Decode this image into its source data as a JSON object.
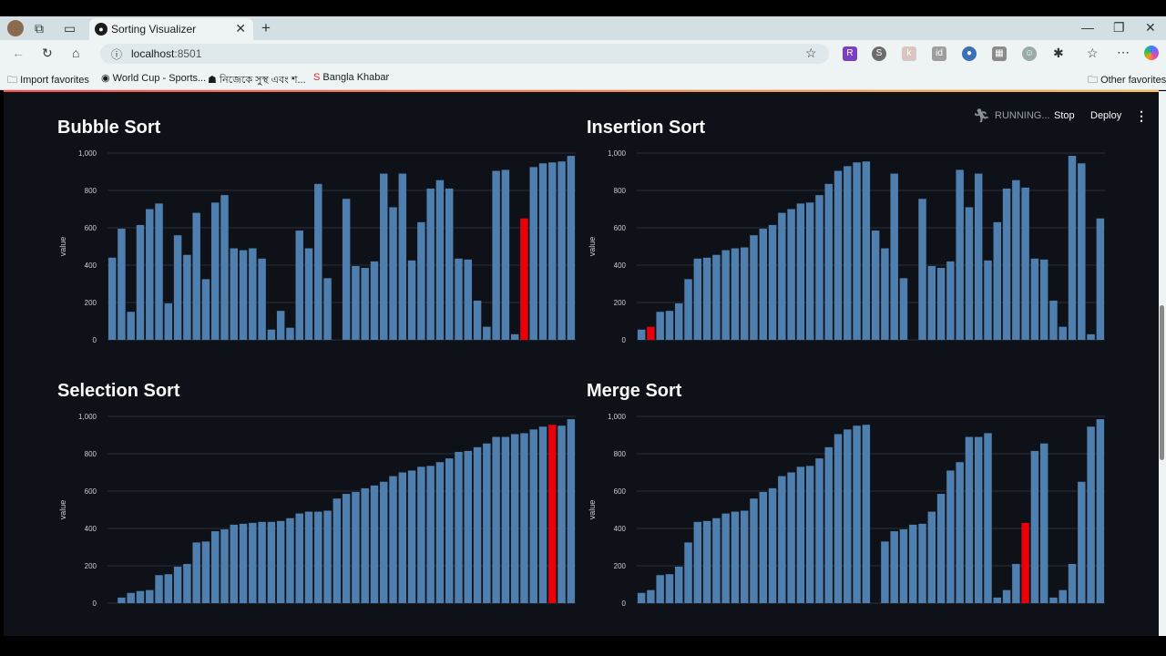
{
  "browser": {
    "tab_title": "Sorting Visualizer",
    "tab_favicon": "streamlit-icon",
    "url_host": "localhost",
    "url_port": ":8501",
    "favorites": [
      {
        "label": "Import favorites"
      },
      {
        "label": "World Cup - Sports..."
      },
      {
        "label": "নিজেকে সুস্থ এবং শ..."
      },
      {
        "label": "Bangla Khabar"
      }
    ],
    "other_favorites": "Other favorites"
  },
  "app_header": {
    "status": "RUNNING...",
    "stop": "Stop",
    "deploy": "Deploy"
  },
  "colors": {
    "bar": "#4e7fae",
    "highlight": "#e8000b",
    "background": "#0e1117",
    "grid": "#2a2f38",
    "tick": "#c9cdd4"
  },
  "chart_data": [
    {
      "type": "bar",
      "title": "Bubble Sort",
      "xlabel": "",
      "ylabel": "value",
      "ylim": [
        0,
        1000
      ],
      "yticks": [
        "0",
        "200",
        "400",
        "600",
        "800",
        "1,000"
      ],
      "values": [
        440,
        595,
        150,
        615,
        700,
        730,
        195,
        560,
        455,
        680,
        325,
        735,
        775,
        490,
        480,
        490,
        435,
        55,
        155,
        65,
        585,
        490,
        835,
        330,
        0,
        755,
        395,
        385,
        420,
        890,
        710,
        890,
        425,
        630,
        810,
        855,
        810,
        435,
        430,
        210,
        70,
        905,
        910,
        30,
        650,
        925,
        945,
        950,
        955,
        985
      ],
      "highlight_indices": [
        44
      ]
    },
    {
      "type": "bar",
      "title": "Insertion Sort",
      "xlabel": "",
      "ylabel": "value",
      "ylim": [
        0,
        1000
      ],
      "yticks": [
        "0",
        "200",
        "400",
        "600",
        "800",
        "1,000"
      ],
      "values": [
        55,
        70,
        150,
        155,
        195,
        325,
        435,
        440,
        455,
        480,
        490,
        495,
        560,
        595,
        615,
        680,
        700,
        730,
        735,
        775,
        835,
        905,
        930,
        950,
        955,
        585,
        490,
        890,
        330,
        0,
        755,
        395,
        385,
        420,
        910,
        710,
        890,
        425,
        630,
        810,
        855,
        815,
        435,
        430,
        210,
        70,
        985,
        945,
        30,
        650
      ],
      "highlight_indices": [
        1
      ]
    },
    {
      "type": "bar",
      "title": "Selection Sort",
      "xlabel": "",
      "ylabel": "value",
      "ylim": [
        0,
        1000
      ],
      "yticks": [
        "0",
        "200",
        "400",
        "600",
        "800",
        "1,000"
      ],
      "values": [
        0,
        30,
        55,
        65,
        70,
        150,
        155,
        195,
        210,
        325,
        330,
        385,
        395,
        420,
        425,
        430,
        435,
        435,
        440,
        455,
        480,
        490,
        490,
        495,
        560,
        585,
        595,
        615,
        630,
        650,
        680,
        700,
        710,
        730,
        735,
        755,
        775,
        810,
        815,
        835,
        855,
        890,
        890,
        905,
        910,
        930,
        945,
        955,
        950,
        985
      ],
      "highlight_indices": [
        47
      ]
    },
    {
      "type": "bar",
      "title": "Merge Sort",
      "xlabel": "",
      "ylabel": "value",
      "ylim": [
        0,
        1000
      ],
      "yticks": [
        "0",
        "200",
        "400",
        "600",
        "800",
        "1,000"
      ],
      "values": [
        55,
        70,
        150,
        155,
        195,
        325,
        435,
        440,
        455,
        480,
        490,
        495,
        560,
        595,
        615,
        680,
        700,
        730,
        735,
        775,
        835,
        905,
        930,
        950,
        955,
        0,
        330,
        385,
        395,
        420,
        425,
        490,
        585,
        710,
        755,
        890,
        890,
        910,
        30,
        70,
        210,
        430,
        815,
        855,
        30,
        70,
        210,
        650,
        945,
        985
      ],
      "highlight_indices": [
        41
      ]
    }
  ]
}
